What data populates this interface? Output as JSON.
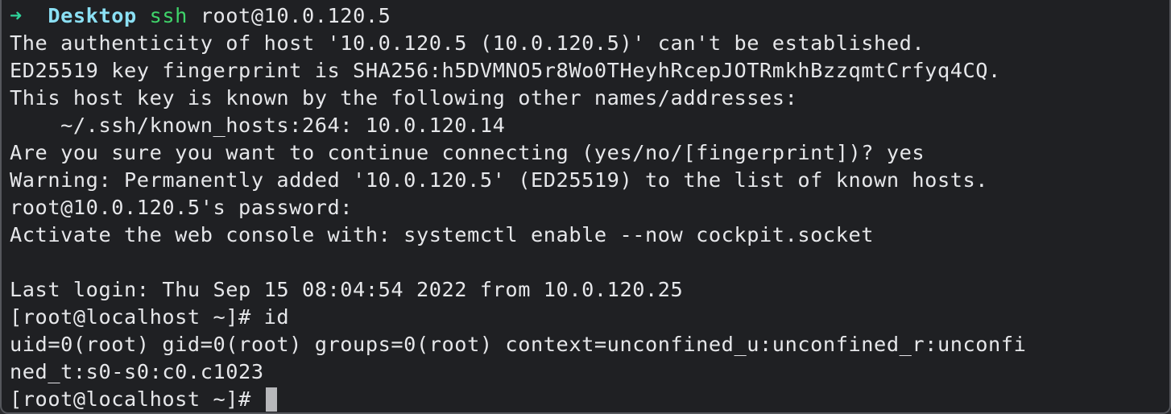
{
  "prompt": {
    "arrow": "➜",
    "directory": "Desktop",
    "command": "ssh",
    "args": "root@10.0.120.5"
  },
  "output_lines": [
    "The authenticity of host '10.0.120.5 (10.0.120.5)' can't be established.",
    "ED25519 key fingerprint is SHA256:h5DVMNO5r8Wo0THeyhRcepJOTRmkhBzzqmtCrfyq4CQ.",
    "This host key is known by the following other names/addresses:",
    "    ~/.ssh/known_hosts:264: 10.0.120.14",
    "Are you sure you want to continue connecting (yes/no/[fingerprint])? yes",
    "Warning: Permanently added '10.0.120.5' (ED25519) to the list of known hosts.",
    "root@10.0.120.5's password:",
    "Activate the web console with: systemctl enable --now cockpit.socket",
    "",
    "Last login: Thu Sep 15 08:04:54 2022 from 10.0.120.25",
    "[root@localhost ~]# id",
    "uid=0(root) gid=0(root) groups=0(root) context=unconfined_u:unconfined_r:unconfi",
    "ned_t:s0-s0:c0.c1023"
  ],
  "current_prompt": "[root@localhost ~]# ",
  "colors": {
    "background": "#1f2023",
    "foreground": "#e6e7ea",
    "arrow": "#2fd39a",
    "directory": "#8be0f4",
    "command": "#3fd46a",
    "cursor": "#b7b8bb"
  }
}
